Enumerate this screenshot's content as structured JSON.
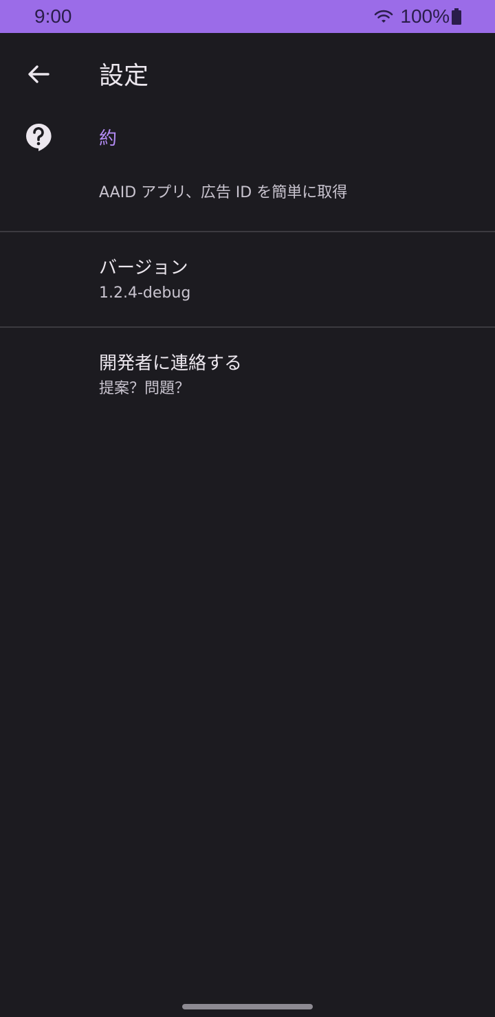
{
  "status_bar": {
    "time": "9:00",
    "battery": "100%",
    "icons": [
      "wifi-icon",
      "battery-icon"
    ]
  },
  "toolbar": {
    "title": "設定",
    "back_icon": "arrow-back-icon"
  },
  "about": {
    "icon": "help-bubble-icon",
    "category": "約",
    "description": "AAID アプリ、広告 ID を簡単に取得"
  },
  "preferences": [
    {
      "title": "バージョン",
      "summary": "1.2.4-debug"
    },
    {
      "title": "開発者に連絡する",
      "summary": "提案？問題？"
    }
  ],
  "colors": {
    "status_bar": "#9b6ce8",
    "background": "#1c1b20",
    "accent": "#b48cf6"
  }
}
